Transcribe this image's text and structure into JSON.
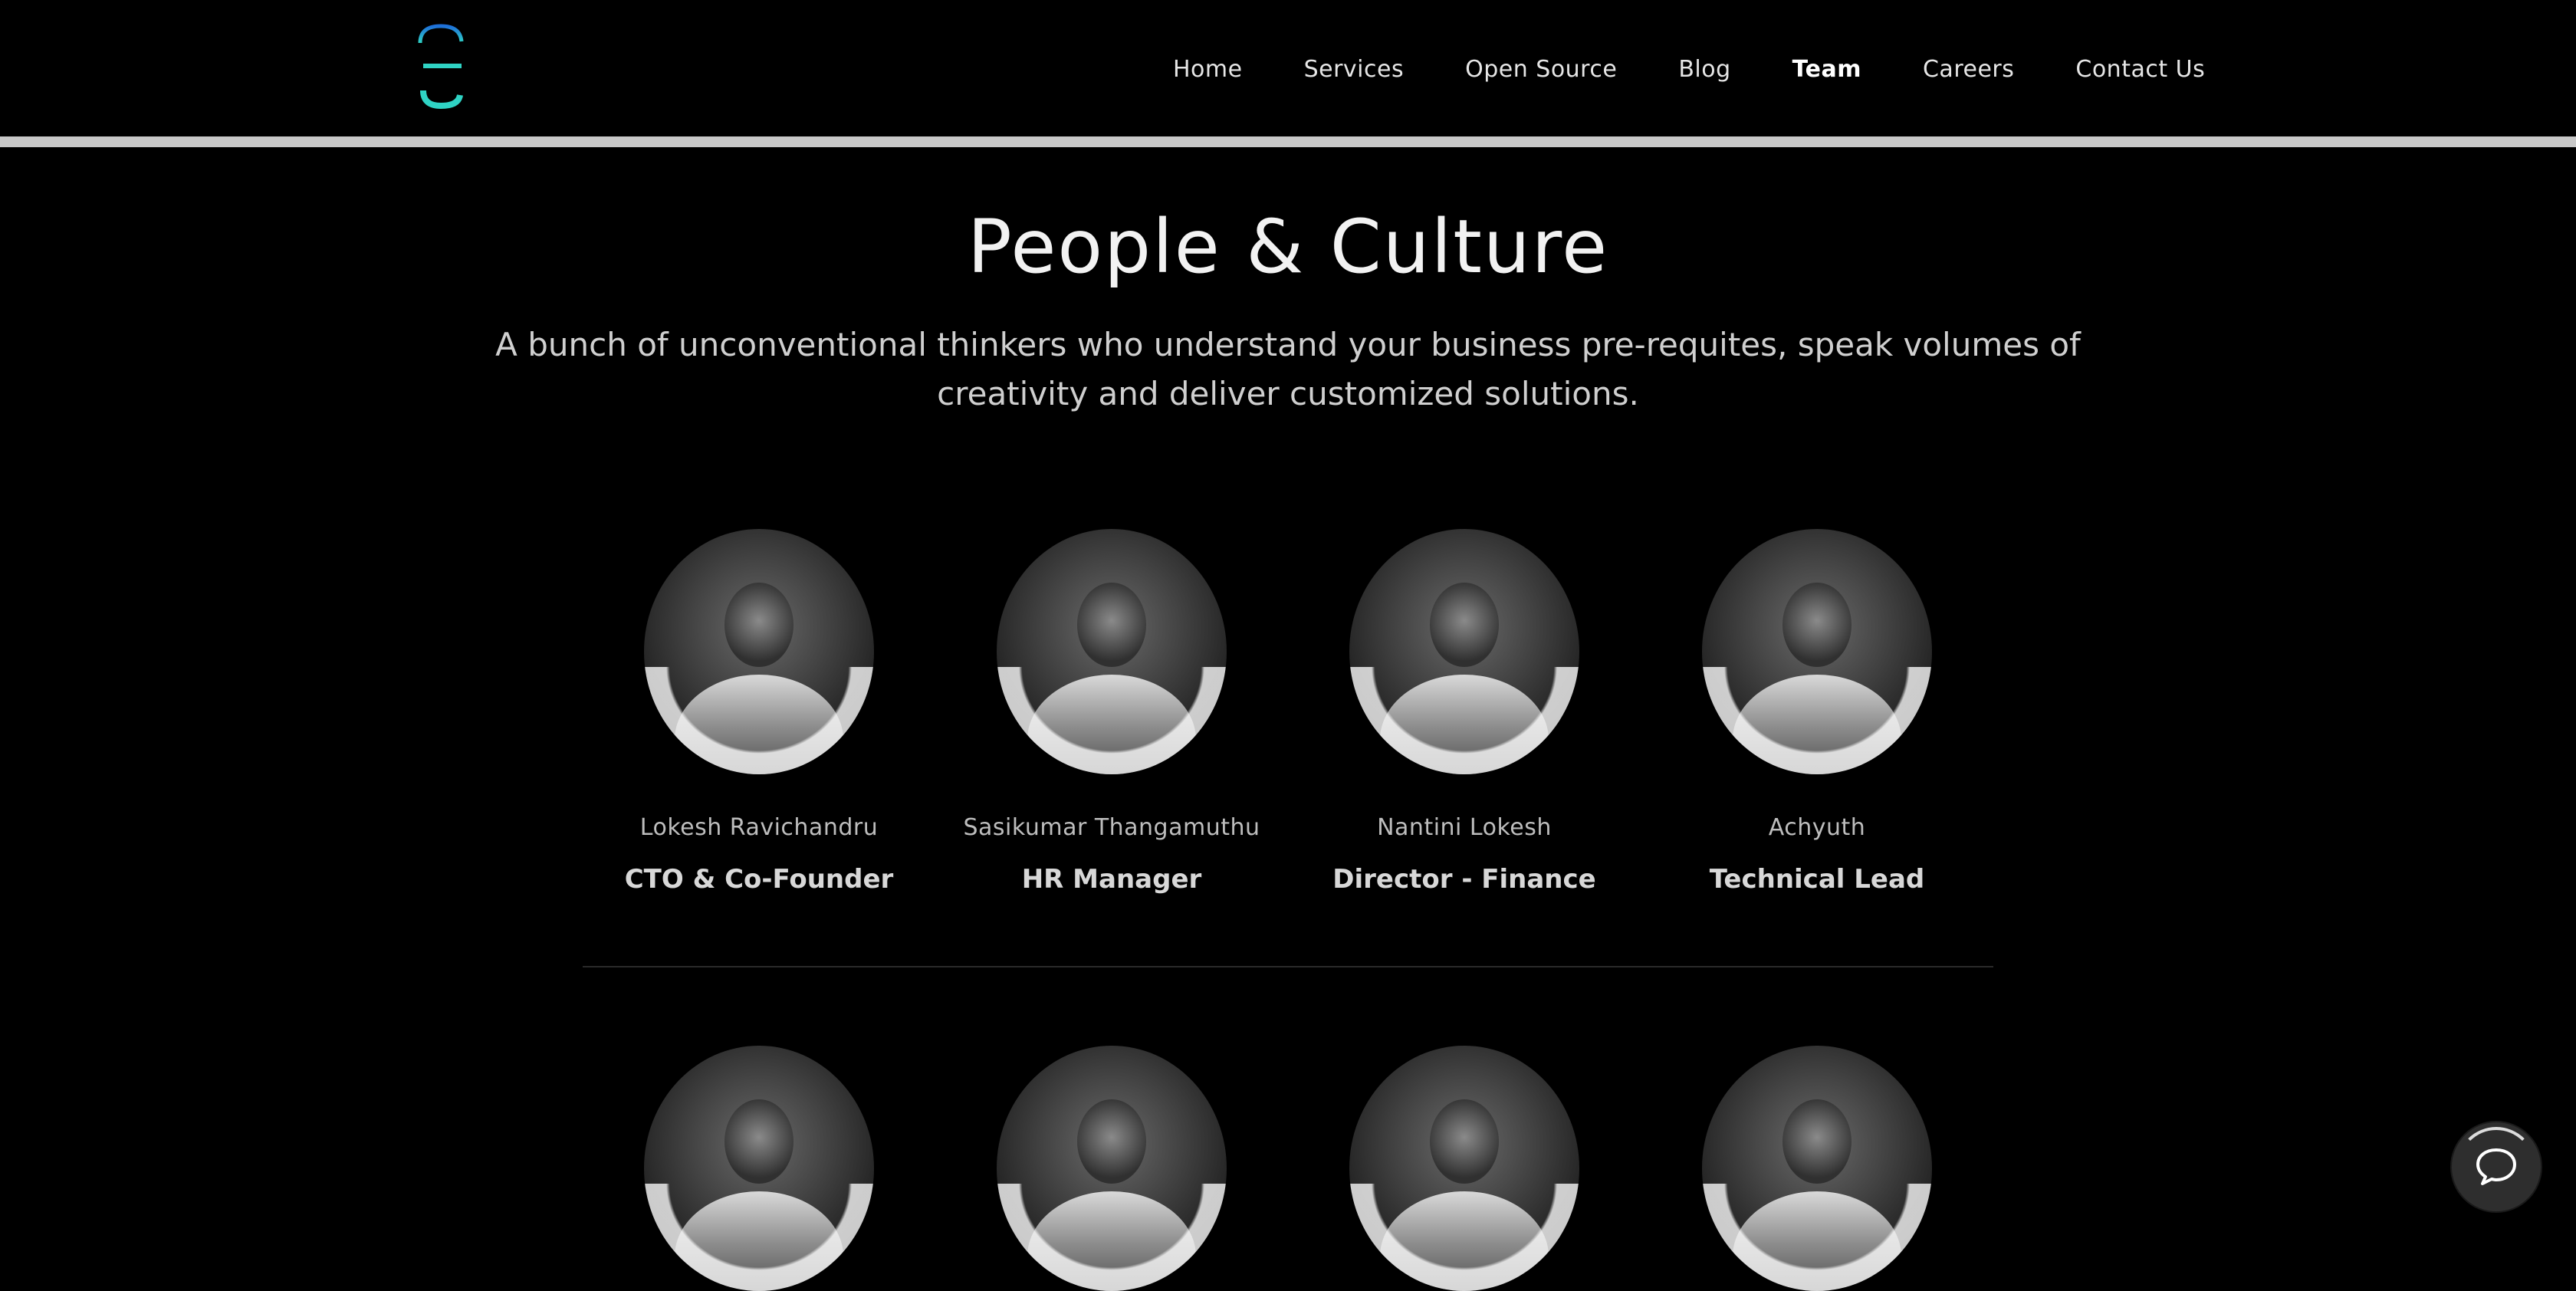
{
  "header": {
    "logo_icon": "company-logo",
    "brand_colors": {
      "logo_top": "#1e6fd9",
      "logo_bottom": "#2fd3c4"
    },
    "nav": [
      {
        "label": "Home"
      },
      {
        "label": "Services"
      },
      {
        "label": "Open Source"
      },
      {
        "label": "Blog"
      },
      {
        "label": "Team",
        "active": true
      },
      {
        "label": "Careers"
      },
      {
        "label": "Contact Us"
      }
    ]
  },
  "hero": {
    "title": "People & Culture",
    "subtitle": "A bunch of unconventional thinkers who understand your business pre-requites, speak volumes of creativity and deliver customized solutions."
  },
  "team": {
    "row1": [
      {
        "name": "Lokesh Ravichandru",
        "role": "CTO & Co-Founder"
      },
      {
        "name": "Sasikumar Thangamuthu",
        "role": "HR Manager"
      },
      {
        "name": "Nantini Lokesh",
        "role": "Director - Finance"
      },
      {
        "name": "Achyuth",
        "role": "Technical Lead"
      }
    ],
    "row2": [
      {
        "name": "",
        "role": ""
      },
      {
        "name": "",
        "role": ""
      },
      {
        "name": "",
        "role": ""
      },
      {
        "name": "",
        "role": ""
      }
    ]
  },
  "chat": {
    "icon": "chat-bubble-icon"
  }
}
